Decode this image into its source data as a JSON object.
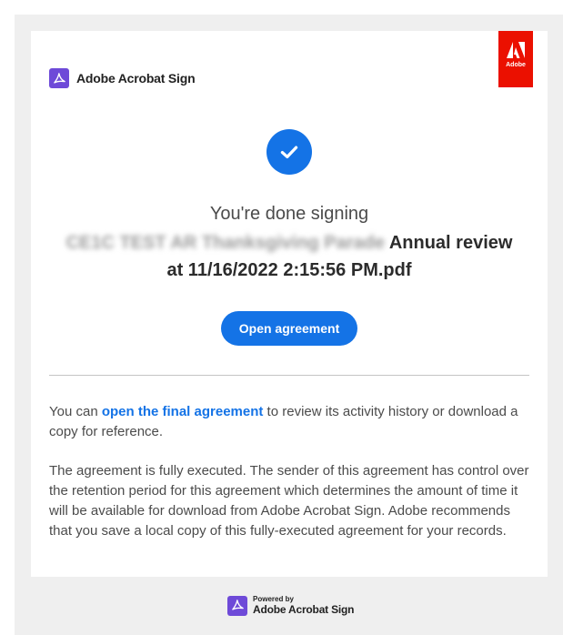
{
  "header": {
    "brand_name": "Adobe Acrobat Sign",
    "adobe_badge_label": "Adobe",
    "icon": "acrobat-sign-icon"
  },
  "main": {
    "title": "You're done signing",
    "filename_blurred": "CE1C TEST AR Thanksgiving Parade",
    "filename_visible_part1": " Annual review",
    "filename_visible_part2": "at 11/16/2022 2:15:56 PM.pdf",
    "open_button_label": "Open agreement"
  },
  "info": {
    "para1_prefix": "You can ",
    "para1_link": "open the final agreement",
    "para1_suffix": " to review its activity history or download a copy for reference.",
    "para2": "The agreement is fully executed. The sender of this agreement has control over the retention period for this agreement which determines the amount of time it will be available for download from Adobe Acrobat Sign. Adobe recommends that you save a local copy of this fully-executed agreement for your records."
  },
  "footer": {
    "powered_by": "Powered by",
    "brand_name": "Adobe Acrobat Sign"
  },
  "colors": {
    "accent": "#1473e6",
    "acrobat_purple": "#6e4ad8",
    "adobe_red": "#eb1000"
  }
}
